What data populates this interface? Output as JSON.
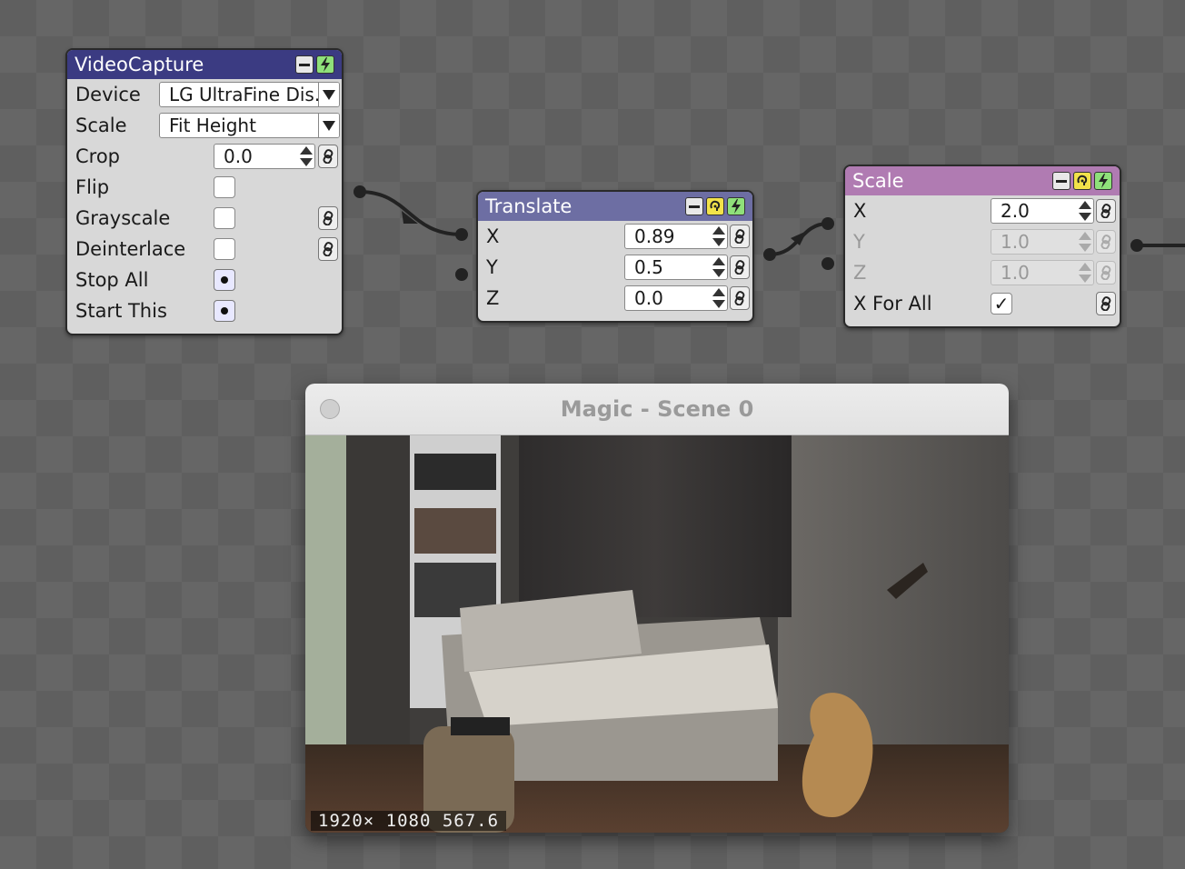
{
  "colors": {
    "videocapture_header": "#3b3b82",
    "translate_header": "#6d6ea3",
    "scale_header": "#b07bb2",
    "fire_button": "#8fe07a",
    "ear_button": "#f2e24a"
  },
  "videocapture": {
    "title": "VideoCapture",
    "rows": {
      "device": {
        "label": "Device",
        "value": "LG UltraFine Dis..."
      },
      "scale": {
        "label": "Scale",
        "value": "Fit Height"
      },
      "crop": {
        "label": "Crop",
        "value": "0.0"
      },
      "flip": {
        "label": "Flip",
        "checked": false
      },
      "grayscale": {
        "label": "Grayscale",
        "checked": false
      },
      "deinterlace": {
        "label": "Deinterlace",
        "checked": false
      },
      "stop_all": {
        "label": "Stop All"
      },
      "start_this": {
        "label": "Start This"
      }
    }
  },
  "translate": {
    "title": "Translate",
    "rows": {
      "x": {
        "label": "X",
        "value": "0.89"
      },
      "y": {
        "label": "Y",
        "value": "0.5"
      },
      "z": {
        "label": "Z",
        "value": "0.0"
      }
    }
  },
  "scale_node": {
    "title": "Scale",
    "rows": {
      "x": {
        "label": "X",
        "value": "2.0"
      },
      "y": {
        "label": "Y",
        "value": "1.0"
      },
      "z": {
        "label": "Z",
        "value": "1.0"
      },
      "x_for_all": {
        "label": "X For All",
        "check": "✓"
      }
    }
  },
  "scene": {
    "title": "Magic - Scene 0",
    "status": "1920× 1080  567.6"
  },
  "icons": [
    "minimize-icon",
    "fire-icon",
    "ear-icon",
    "link-icon",
    "dropdown-arrow-icon",
    "stepper-icon",
    "checkmark-icon",
    "window-close-icon"
  ]
}
